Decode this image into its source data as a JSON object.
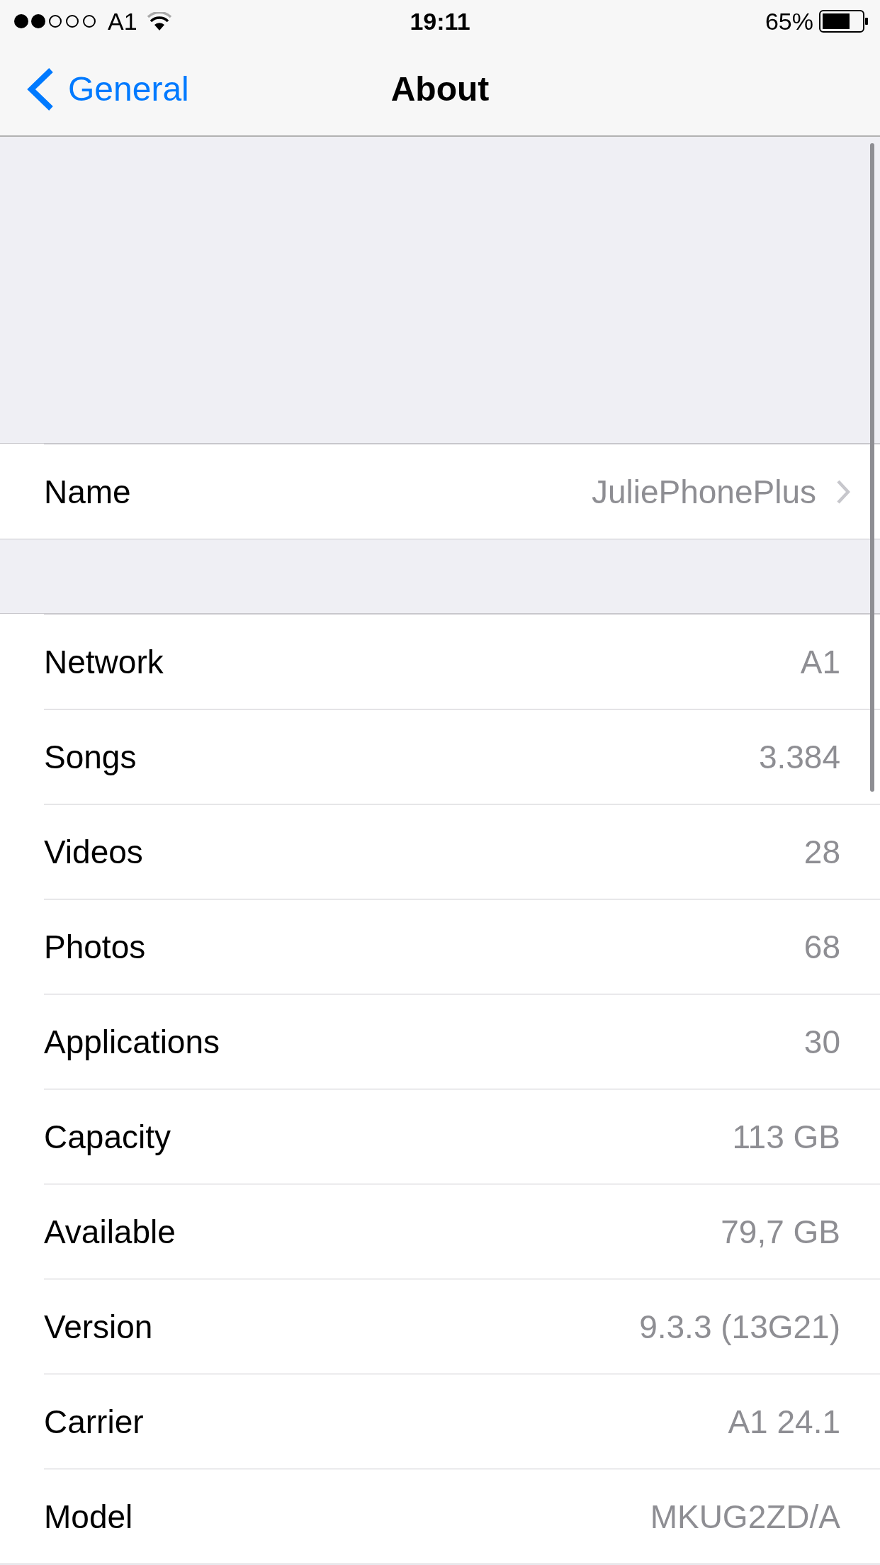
{
  "status_bar": {
    "carrier": "A1",
    "time": "19:11",
    "battery": "65%"
  },
  "nav_bar": {
    "back": "General",
    "title": "About"
  },
  "sections": [
    {
      "rows": [
        {
          "label": "Name",
          "value": "JuliePhonePlus",
          "kind": "link"
        }
      ]
    },
    {
      "rows": [
        {
          "label": "Network",
          "value": "A1",
          "kind": "info"
        },
        {
          "label": "Songs",
          "value": "3.384",
          "kind": "info"
        },
        {
          "label": "Videos",
          "value": "28",
          "kind": "info"
        },
        {
          "label": "Photos",
          "value": "68",
          "kind": "info"
        },
        {
          "label": "Applications",
          "value": "30",
          "kind": "info"
        },
        {
          "label": "Capacity",
          "value": "113 GB",
          "kind": "info"
        },
        {
          "label": "Available",
          "value": "79,7 GB",
          "kind": "info"
        },
        {
          "label": "Version",
          "value": "9.3.3 (13G21)",
          "kind": "info"
        },
        {
          "label": "Carrier",
          "value": "A1 24.1",
          "kind": "info"
        },
        {
          "label": "Model",
          "value": "MKUG2ZD/A",
          "kind": "info"
        }
      ]
    }
  ]
}
